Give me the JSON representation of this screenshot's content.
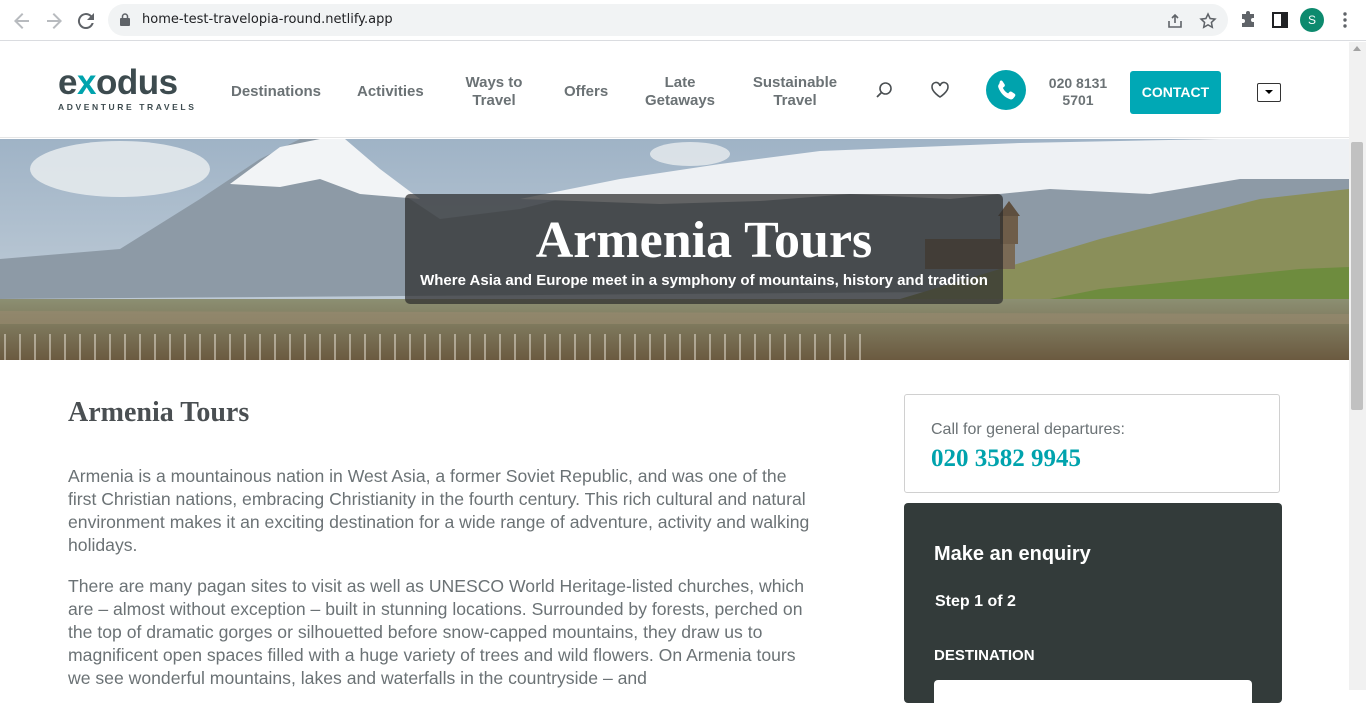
{
  "browser": {
    "url": "home-test-travelopia-round.netlify.app",
    "profile_initial": "S"
  },
  "header": {
    "logo_word_pre": "e",
    "logo_word_x": "x",
    "logo_word_post": "odus",
    "logo_tagline": "ADVENTURE TRAVELS",
    "nav": {
      "destinations": "Destinations",
      "activities": "Activities",
      "ways_line1": "Ways to",
      "ways_line2": "Travel",
      "offers": "Offers",
      "late_line1": "Late",
      "late_line2": "Getaways",
      "sustainable_line1": "Sustainable",
      "sustainable_line2": "Travel"
    },
    "phone_line1": "020 8131",
    "phone_line2": "5701",
    "contact_label": "CONTACT"
  },
  "hero": {
    "title": "Armenia Tours",
    "subtitle": "Where Asia and Europe meet in a symphony of mountains, history and tradition"
  },
  "main": {
    "title": "Armenia Tours",
    "paragraphs": [
      "Armenia is a mountainous nation in West Asia, a former Soviet Republic, and was one of the first Christian nations, embracing Christianity in the fourth century. This rich cultural and natural environment makes it an exciting destination for a wide range of adventure, activity and walking holidays.",
      "There are many pagan sites to visit as well as UNESCO World Heritage-listed churches, which are – almost without exception – built in stunning locations. Surrounded by forests, perched on the top of dramatic gorges or silhouetted before snow-capped mountains, they draw us to magnificent open spaces filled with a huge variety of trees and wild flowers. On Armenia tours we see wonderful mountains, lakes and waterfalls in the countryside – and"
    ]
  },
  "sidebar": {
    "call_label": "Call for general departures:",
    "call_number": "020 3582 9945",
    "enquiry_title": "Make an enquiry",
    "enquiry_step": "Step 1 of 2",
    "destination_label": "DESTINATION"
  },
  "colors": {
    "brand_teal": "#00a3ad",
    "logo_dark": "#3d4b4f",
    "enquiry_bg": "#333b3a"
  }
}
